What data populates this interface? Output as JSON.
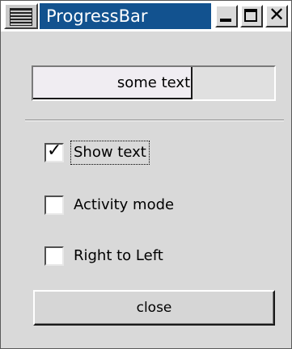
{
  "window": {
    "title": "ProgressBar",
    "title_bg_color": "#12528f",
    "close_glyph": "✕"
  },
  "progress": {
    "text": "some text",
    "fraction": 0.66
  },
  "options": [
    {
      "label": "Show text",
      "checked": true,
      "tick": "✓"
    },
    {
      "label": "Activity mode",
      "checked": false,
      "tick": ""
    },
    {
      "label": "Right to Left",
      "checked": false,
      "tick": ""
    }
  ],
  "buttons": {
    "close_label": "close"
  }
}
